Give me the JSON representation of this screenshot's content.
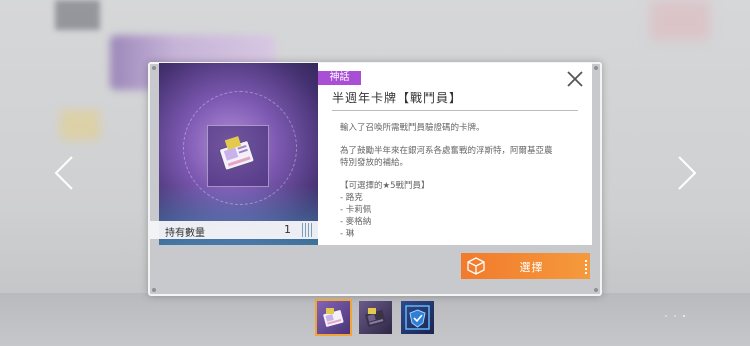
{
  "card": {
    "rarity_badge": "神話",
    "title": "半週年卡牌【戰鬥員】",
    "quantity_label": "持有數量",
    "quantity_value": "1",
    "description": [
      "輸入了召喚所需戰鬥員驗證碼的卡牌。",
      "",
      "為了鼓勵半年來在銀河系各處奮戰的浮斯特，阿爾基亞農",
      "特別發放的補給。",
      "",
      "【可選擇的★5戰鬥員】",
      "- 路克",
      "- 卡莉佩",
      "- 麥格納",
      "- 琳"
    ]
  },
  "actions": {
    "select_label": "選擇"
  },
  "colors": {
    "rarity_badge": "#a84fd6",
    "select_button": "#f27a2c"
  },
  "thumbnails": [
    {
      "icon": "half-anniversary-card-icon",
      "selected": true
    },
    {
      "icon": "dark-card-icon",
      "selected": false
    },
    {
      "icon": "blue-shield-card-icon",
      "selected": false
    }
  ]
}
